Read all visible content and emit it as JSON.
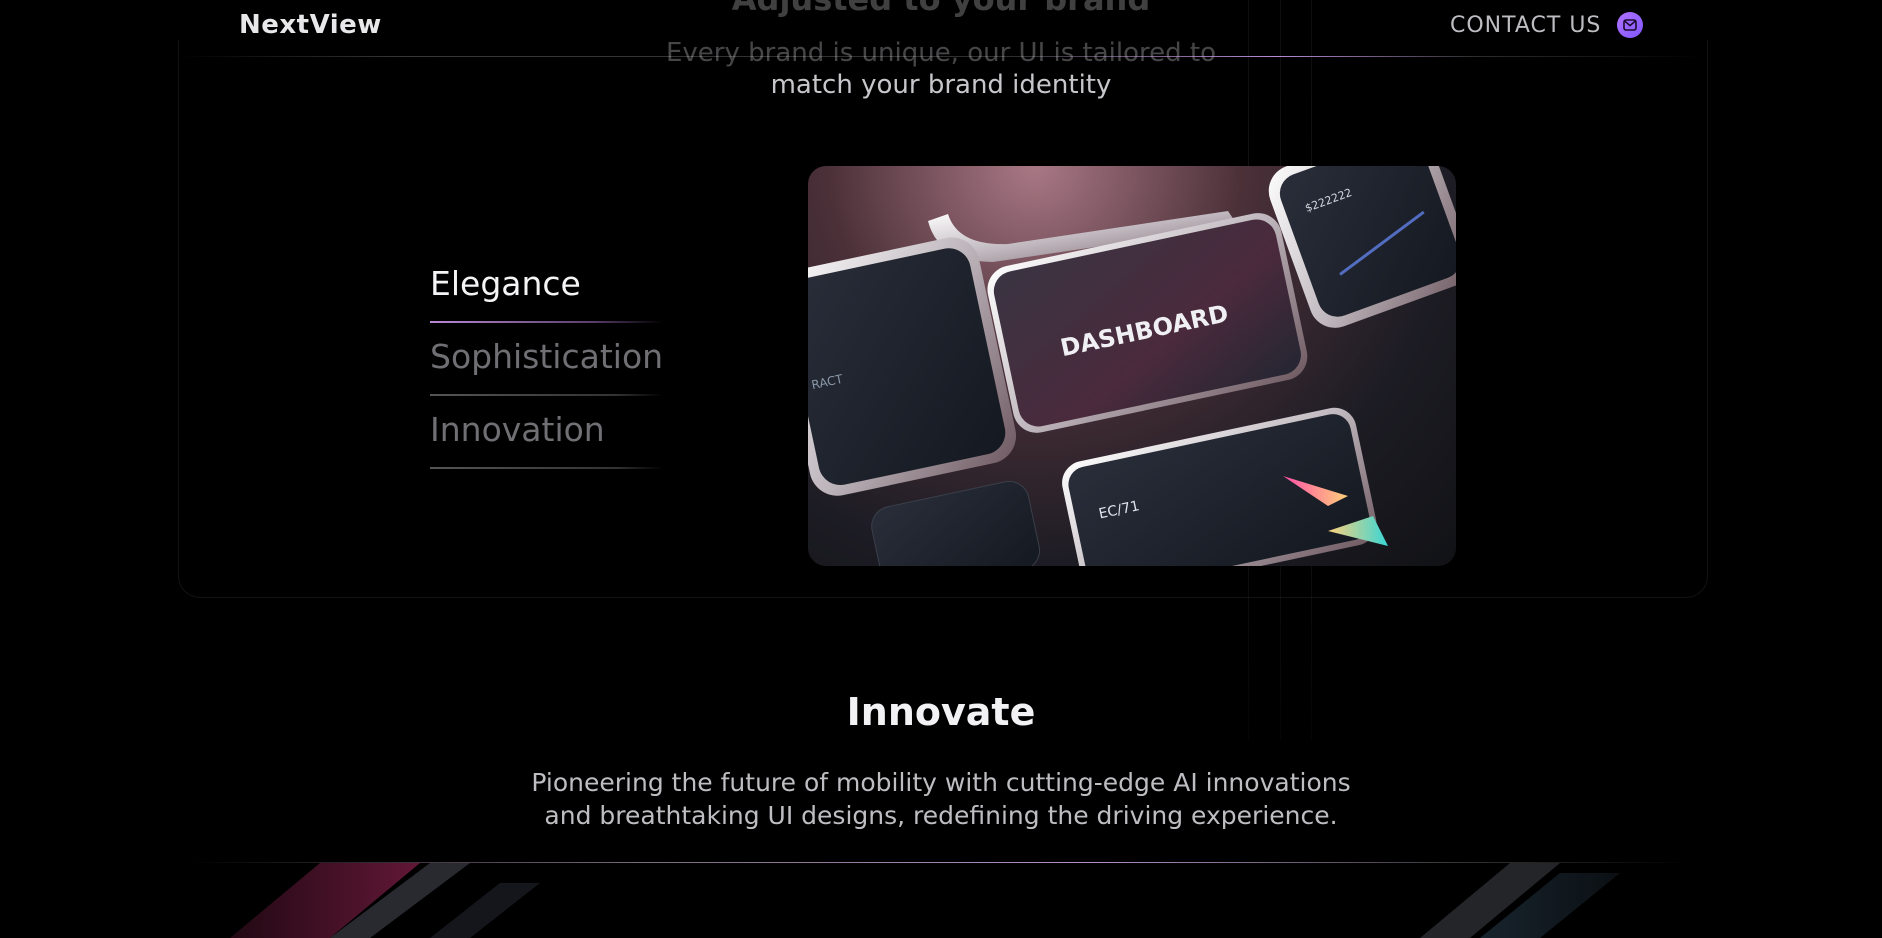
{
  "header": {
    "logo": "NextView",
    "contact_label": "CONTACT US",
    "contact_icon": "mail-icon",
    "accent": "#9b6bff"
  },
  "intro": {
    "heading_partial": "Adjusted to your brand",
    "subtitle_line1": "Every brand is unique, our UI is tailored to",
    "subtitle_line2": "match your brand identity"
  },
  "features": {
    "tabs": [
      {
        "label": "Elegance",
        "active": true
      },
      {
        "label": "Sophistication",
        "active": false
      },
      {
        "label": "Innovation",
        "active": false
      }
    ],
    "image": {
      "main_label": "DASHBOARD",
      "card_code": "EC/71"
    }
  },
  "innovate": {
    "title": "Innovate",
    "description_line1": "Pioneering the future of mobility with cutting-edge AI innovations",
    "description_line2": "and breathtaking UI designs, redefining the driving experience."
  }
}
